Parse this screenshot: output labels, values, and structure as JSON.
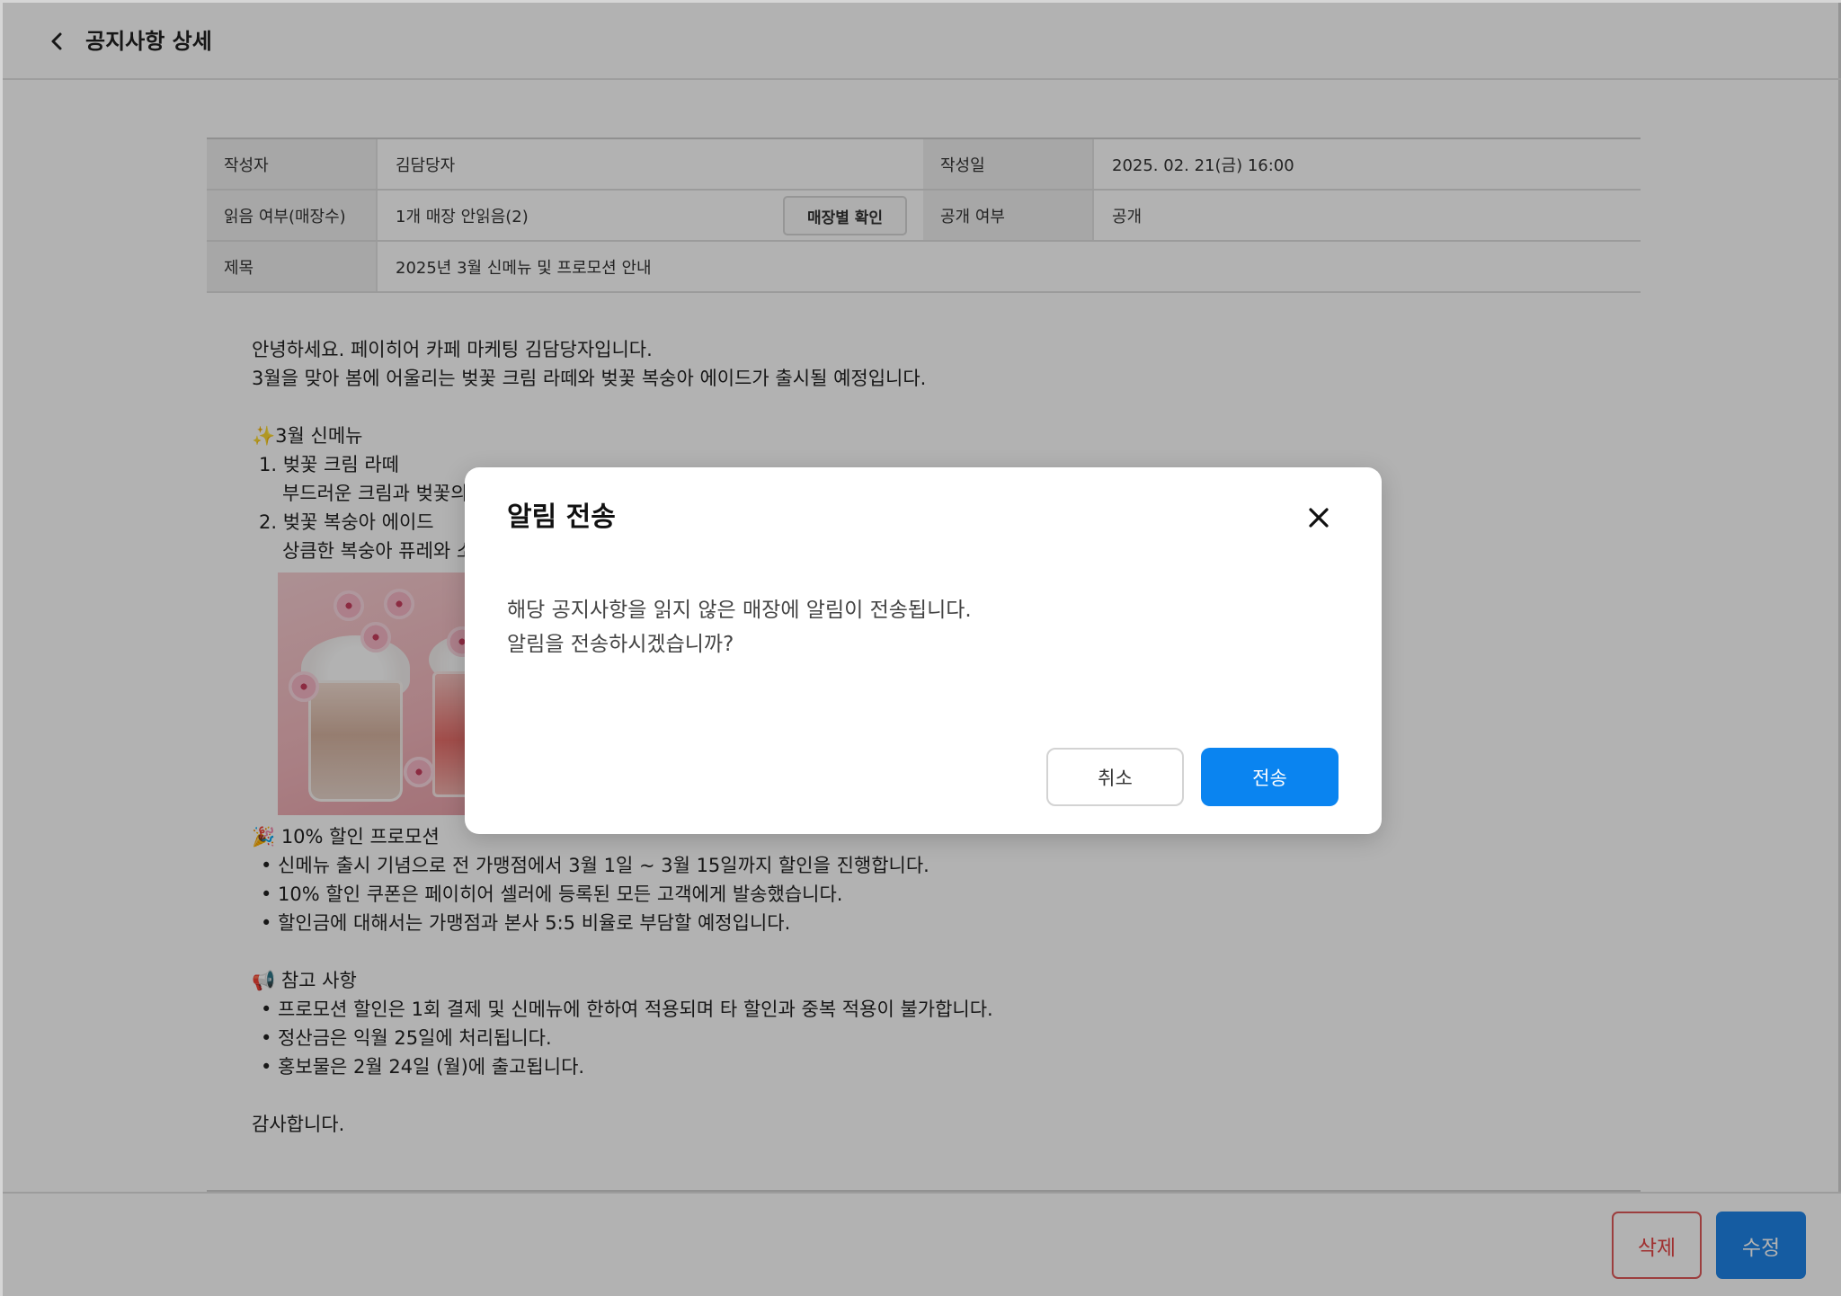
{
  "header": {
    "title": "공지사항 상세"
  },
  "info": {
    "author_label": "작성자",
    "author_value": "김담당자",
    "date_label": "작성일",
    "date_value": "2025. 02. 21(금) 16:00",
    "read_label": "읽음 여부(매장수)",
    "read_value": "1개 매장 안읽음(2)",
    "store_check_button": "매장별 확인",
    "public_label": "공개 여부",
    "public_value": "공개",
    "subject_label": "제목",
    "subject_value": "2025년 3월 신메뉴 및 프로모션 안내"
  },
  "content": {
    "greeting": "안녕하세요. 페이히어 카페 마케팅 김담당자입니다.",
    "intro": "3월을 맞아 봄에 어울리는 벚꽃 크림 라떼와 벚꽃 복숭아 에이드가 출시될 예정입니다.",
    "menu_heading": "✨3월 신메뉴",
    "menu_items": [
      {
        "title": "1. 벚꽃 크림 라떼",
        "desc": "부드러운 크림과 벚꽃의"
      },
      {
        "title": "2. 벚꽃 복숭아 에이드",
        "desc": "상큼한 복숭아 퓨레와 소"
      }
    ],
    "promo_heading": "🎉 10% 할인 프로모션",
    "promo_items": [
      "• 신메뉴 출시 기념으로 전 가맹점에서 3월 1일 ~ 3월 15일까지 할인을 진행합니다.",
      "• 10% 할인 쿠폰은 페이히어 셀러에 등록된 모든 고객에게 발송했습니다.",
      "• 할인금에 대해서는 가맹점과 본사 5:5 비율로 부담할 예정입니다."
    ],
    "notes_heading": "📢 참고 사항",
    "notes_items": [
      "• 프로모션 할인은 1회 결제 및 신메뉴에 한하여 적용되며 타 할인과 중복 적용이 불가합니다.",
      "• 정산금은 익월 25일에 처리됩니다.",
      "• 홍보물은 2월 24일 (월)에 출고됩니다."
    ],
    "closing": "감사합니다."
  },
  "footer": {
    "delete_label": "삭제",
    "edit_label": "수정"
  },
  "modal": {
    "title": "알림 전송",
    "message_line1": "해당 공지사항을 읽지 않은 매장에 알림이 전송됩니다.",
    "message_line2": "알림을 전송하시겠습니까?",
    "cancel_label": "취소",
    "send_label": "전송"
  },
  "colors": {
    "primary": "#0a84f0",
    "edit_button": "#1f85e8",
    "delete_text": "#e54545",
    "overlay": "rgba(0,0,0,0.30)"
  },
  "icons": {
    "back": "chevron-left-icon",
    "close": "close-icon"
  }
}
